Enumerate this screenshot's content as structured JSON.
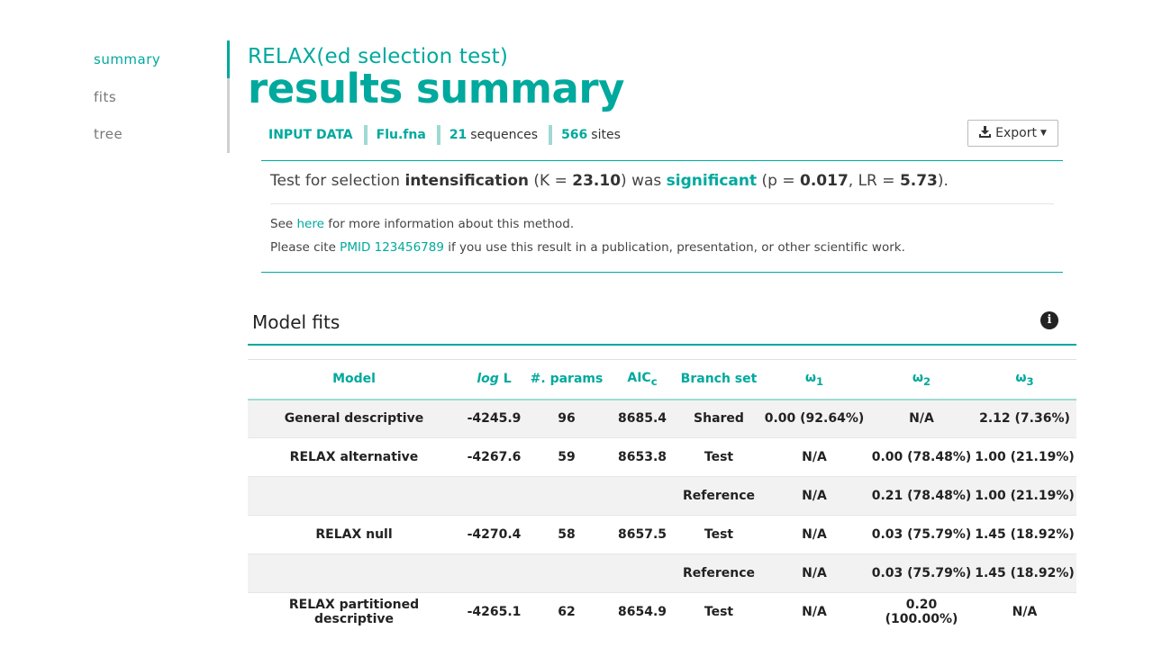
{
  "nav": {
    "items": [
      {
        "label": "summary",
        "active": true
      },
      {
        "label": "fits",
        "active": false
      },
      {
        "label": "tree",
        "active": false
      }
    ]
  },
  "header": {
    "subtitle": "RELAX(ed selection test)",
    "title": "results summary"
  },
  "meta": {
    "input_label": "INPUT DATA",
    "file": "Flu.fna",
    "sequences_count": "21",
    "sequences_word": "sequences",
    "sites_count": "566",
    "sites_word": "sites"
  },
  "export": {
    "label": "Export",
    "icon": "download-icon"
  },
  "summary": {
    "prefix": "Test for selection",
    "test_type": "intensification",
    "k_open": "(K =",
    "k_value": "23.10",
    "k_close": ") was",
    "result": "significant",
    "p_open": "(p =",
    "p_value": "0.017",
    "lr_mid": ", LR =",
    "lr_value": "5.73",
    "end": ").",
    "see_prefix": "See",
    "see_link": "here",
    "see_suffix": "for more information about this method.",
    "cite_prefix": "Please cite",
    "cite_link": "PMID 123456789",
    "cite_suffix": "if you use this result in a publication, presentation, or other scientific work."
  },
  "model_fits": {
    "title": "Model fits",
    "info_icon": "info-icon",
    "headers": {
      "model": "Model",
      "logl_italic": "log",
      "logl_rest": " L",
      "params": "#. params",
      "aic": "AIC",
      "aic_sub": "c",
      "branch": "Branch set",
      "w1": "ω",
      "w1_sub": "1",
      "w2": "ω",
      "w2_sub": "2",
      "w3": "ω",
      "w3_sub": "3"
    },
    "rows": [
      {
        "model": "General descriptive",
        "logl": "-4245.9",
        "params": "96",
        "aic": "8685.4",
        "branch": "Shared",
        "w1": "0.00 (92.64%)",
        "w2": "N/A",
        "w3": "2.12 (7.36%)"
      },
      {
        "model": "RELAX alternative",
        "logl": "-4267.6",
        "params": "59",
        "aic": "8653.8",
        "branch": "Test",
        "w1": "N/A",
        "w2": "0.00 (78.48%)",
        "w3": "1.00 (21.19%)"
      },
      {
        "model": "",
        "logl": "",
        "params": "",
        "aic": "",
        "branch": "Reference",
        "w1": "N/A",
        "w2": "0.21 (78.48%)",
        "w3": "1.00 (21.19%)"
      },
      {
        "model": "RELAX null",
        "logl": "-4270.4",
        "params": "58",
        "aic": "8657.5",
        "branch": "Test",
        "w1": "N/A",
        "w2": "0.03 (75.79%)",
        "w3": "1.45 (18.92%)"
      },
      {
        "model": "",
        "logl": "",
        "params": "",
        "aic": "",
        "branch": "Reference",
        "w1": "N/A",
        "w2": "0.03 (75.79%)",
        "w3": "1.45 (18.92%)"
      },
      {
        "model": "RELAX partitioned descriptive",
        "logl": "-4265.1",
        "params": "62",
        "aic": "8654.9",
        "branch": "Test",
        "w1": "N/A",
        "w2": "0.20 (100.00%)",
        "w3": "N/A"
      }
    ]
  }
}
